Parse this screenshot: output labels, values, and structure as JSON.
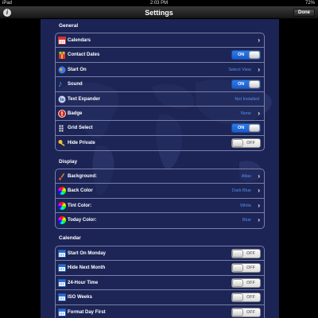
{
  "status_bar": {
    "device": "iPad",
    "time": "2:03 PM",
    "battery": "72%"
  },
  "nav": {
    "title": "Settings",
    "info_label": "i",
    "done_label": "Done"
  },
  "sections": {
    "general": {
      "title": "General",
      "rows": [
        {
          "label": "Calendars",
          "icon": "calendar-grid-icon",
          "control": "chevron"
        },
        {
          "label": "Contact Dates",
          "icon": "birthday-gift-icon",
          "control": "toggle",
          "state": "ON"
        },
        {
          "label": "Start On",
          "icon": "globe-icon",
          "value": "Select View",
          "control": "chevron"
        },
        {
          "label": "Sound",
          "icon": "music-note-icon",
          "control": "toggle",
          "state": "ON"
        },
        {
          "label": "Text Expander",
          "icon": "text-expander-icon",
          "value": "Not Installed",
          "control": "none"
        },
        {
          "label": "Badge",
          "icon": "badge-icon",
          "value": "None",
          "control": "chevron"
        },
        {
          "label": "Grid Select",
          "icon": "grid-icon",
          "control": "toggle",
          "state": "ON"
        },
        {
          "label": "Hide Private",
          "icon": "key-icon",
          "control": "toggle",
          "state": "OFF"
        }
      ]
    },
    "display": {
      "title": "Display",
      "rows": [
        {
          "label": "Background:",
          "icon": "paintbrush-icon",
          "value": "Atlas",
          "control": "chevron"
        },
        {
          "label": "Back Color",
          "icon": "color-wheel-icon",
          "value": "Dark Blue",
          "control": "chevron"
        },
        {
          "label": "Tint Color:",
          "icon": "color-wheel-icon",
          "value": "White",
          "control": "chevron"
        },
        {
          "label": "Today Color:",
          "icon": "color-wheel-icon",
          "value": "Blue",
          "control": "chevron"
        }
      ]
    },
    "calendar": {
      "title": "Calendar",
      "rows": [
        {
          "label": "Start On Monday",
          "icon": "calendar-icon",
          "control": "toggle",
          "state": "OFF"
        },
        {
          "label": "Hide Next Month",
          "icon": "calendar-icon",
          "control": "toggle",
          "state": "OFF"
        },
        {
          "label": "24-Hour Time",
          "icon": "calendar-icon",
          "control": "toggle",
          "state": "OFF"
        },
        {
          "label": "ISO Weeks",
          "icon": "calendar-icon",
          "control": "toggle",
          "state": "OFF"
        },
        {
          "label": "Format Day First",
          "icon": "calendar-icon",
          "control": "toggle",
          "state": "OFF"
        }
      ]
    }
  },
  "colors": {
    "background": "#1c2456",
    "value_text": "#5a8ee6",
    "toggle_on": "#2a6fd6"
  }
}
